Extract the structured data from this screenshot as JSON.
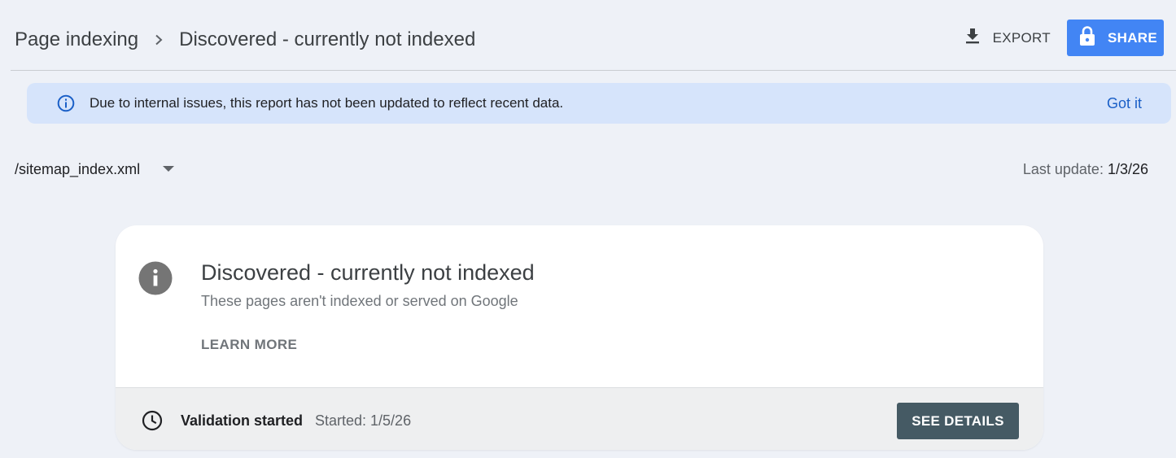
{
  "header": {
    "breadcrumb_parent": "Page indexing",
    "breadcrumb_current": "Discovered - currently not indexed",
    "export_label": "EXPORT",
    "share_label": "SHARE"
  },
  "banner": {
    "message": "Due to internal issues, this report has not been updated to reflect recent data.",
    "dismiss_label": "Got it"
  },
  "filter": {
    "sitemap_value": "/sitemap_index.xml",
    "last_update_label": "Last update: ",
    "last_update_value": "1/3/26"
  },
  "card": {
    "title": "Discovered - currently not indexed",
    "subtitle": "These pages aren't indexed or served on Google",
    "learn_more_label": "LEARN MORE",
    "validation_status": "Validation started",
    "validation_started": "Started: 1/5/26",
    "see_details_label": "SEE DETAILS"
  },
  "icons": {
    "breadcrumb_separator": "chevron-right-icon",
    "export": "download-icon",
    "share": "lock-icon",
    "banner": "info-outline-icon",
    "dropdown": "caret-down-icon",
    "card": "info-filled-icon",
    "validation": "clock-icon"
  },
  "colors": {
    "page_background": "#eef1f7",
    "share_button": "#4285f4",
    "banner_background": "#d6e4fb",
    "banner_link": "#1a5fc7",
    "see_details_button": "#455a64"
  }
}
